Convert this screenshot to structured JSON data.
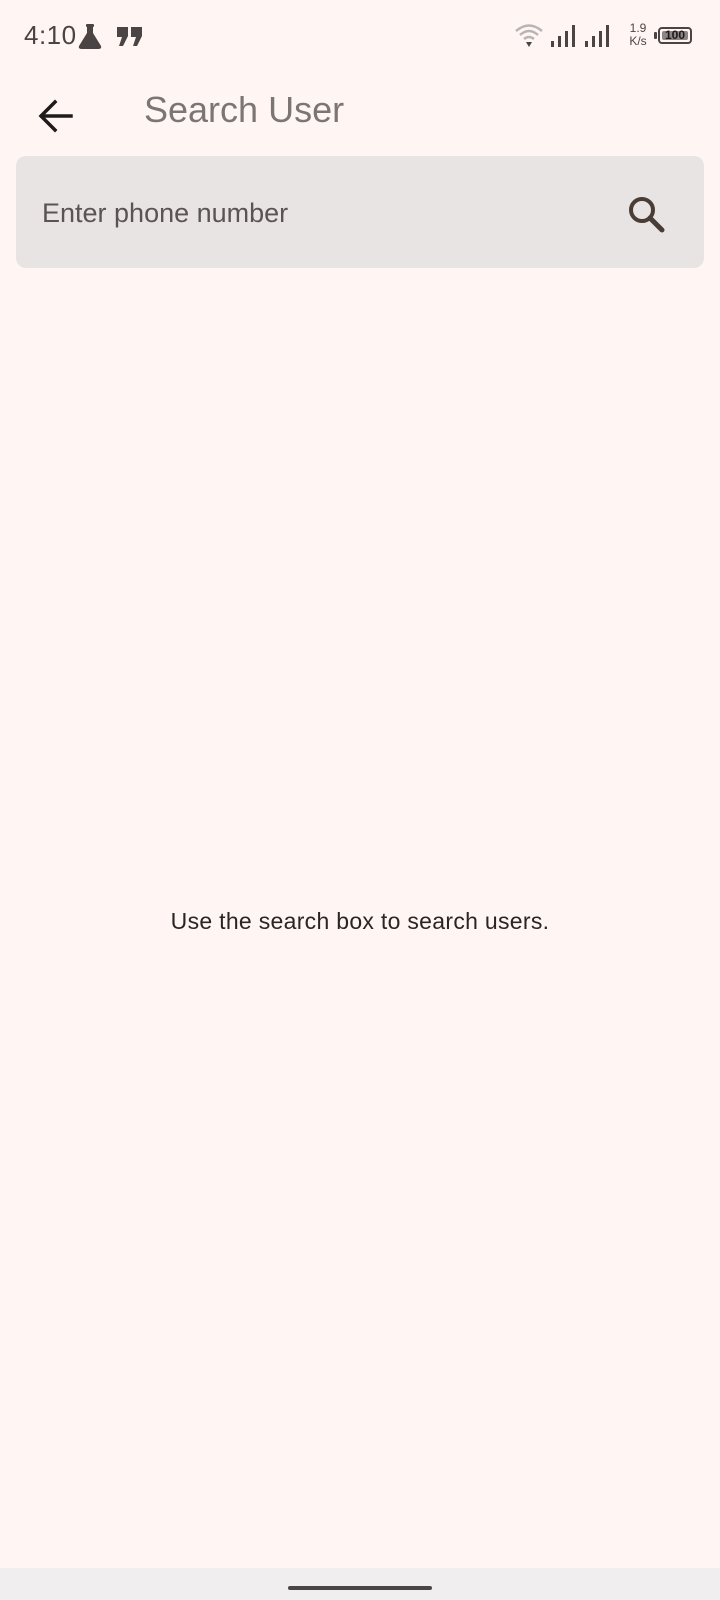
{
  "status_bar": {
    "time": "4:10",
    "net_speed_value": "1.9",
    "net_speed_unit": "K/s",
    "battery_level": "100",
    "icons": [
      "lab-flask-icon",
      "quote-icon",
      "wifi-icon",
      "signal-icon",
      "signal-icon",
      "battery-icon"
    ]
  },
  "app_bar": {
    "title": "Search User",
    "back_icon": "arrow-back-icon"
  },
  "search": {
    "placeholder": "Enter phone number",
    "value": "",
    "icon": "search-icon"
  },
  "empty_state": {
    "message": "Use the search box to search users."
  },
  "colors": {
    "background": "#fff6f3",
    "search_box": "#e8e4e4",
    "title": "#7b7574",
    "text": "#2a2524"
  }
}
